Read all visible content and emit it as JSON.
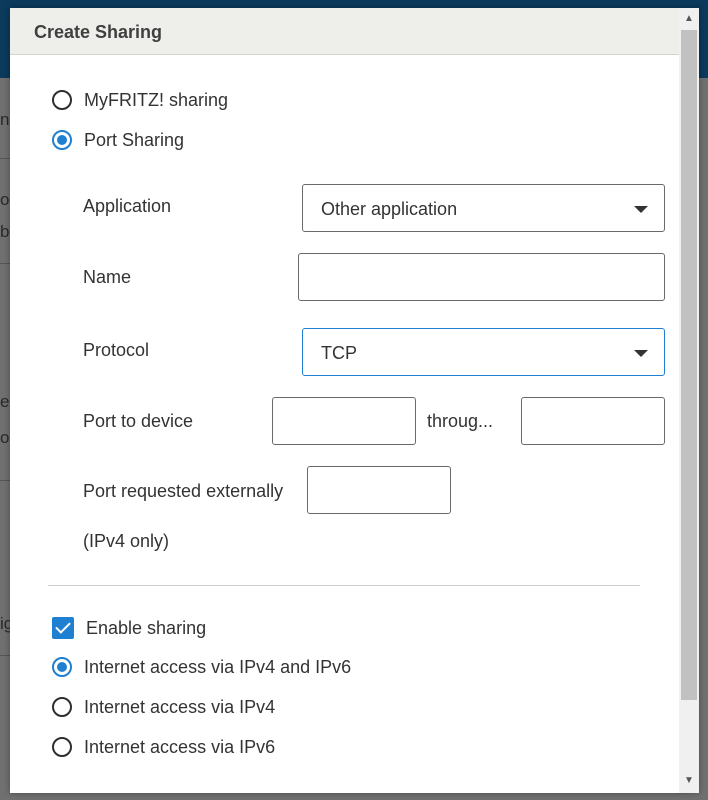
{
  "dialog": {
    "title": "Create Sharing"
  },
  "sharing_type": {
    "options": [
      {
        "label": "MyFRITZ! sharing",
        "selected": false
      },
      {
        "label": "Port Sharing",
        "selected": true
      }
    ]
  },
  "form": {
    "application": {
      "label": "Application",
      "value": "Other application"
    },
    "name": {
      "label": "Name",
      "value": ""
    },
    "protocol": {
      "label": "Protocol",
      "value": "TCP"
    },
    "port_to_device": {
      "label": "Port to device",
      "from": "",
      "through_label": "throug...",
      "to": ""
    },
    "port_external": {
      "label": "Port requested externally",
      "value": "",
      "note": "(IPv4 only)"
    }
  },
  "enable_sharing": {
    "label": "Enable sharing",
    "checked": true
  },
  "internet_access": {
    "options": [
      {
        "label": "Internet access via IPv4 and IPv6",
        "selected": true
      },
      {
        "label": "Internet access via IPv4",
        "selected": false
      },
      {
        "label": "Internet access via IPv6",
        "selected": false
      }
    ]
  },
  "backdrop": {
    "fragments": [
      "n",
      "o",
      "b",
      "e",
      "o",
      "ig"
    ]
  },
  "colors": {
    "accent": "#1f7fd1",
    "header_bg": "#eeeeeb",
    "backdrop_header": "#0b3a5c"
  },
  "icons": {
    "scroll_up": "triangle-up",
    "scroll_down": "triangle-down",
    "select_caret": "triangle-down"
  }
}
